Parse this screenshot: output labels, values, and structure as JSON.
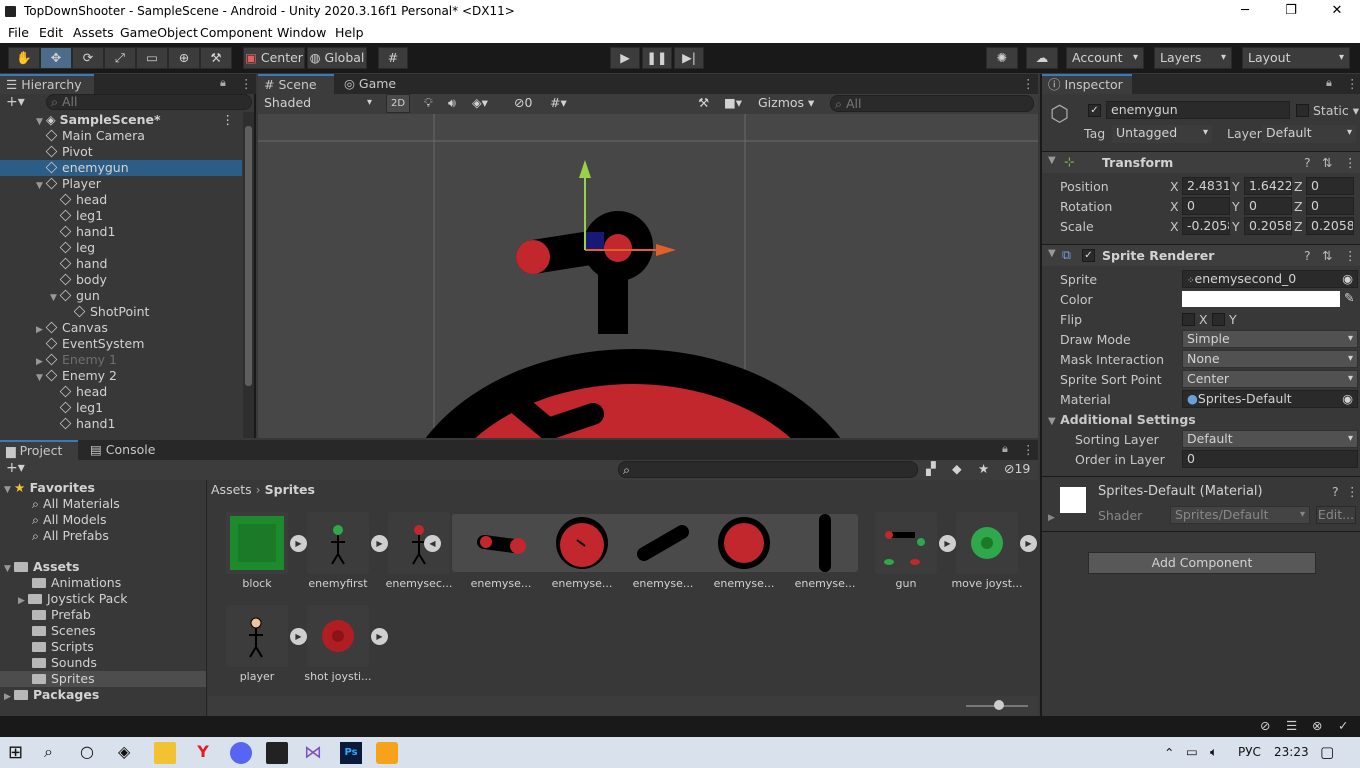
{
  "window": {
    "title": "TopDownShooter - SampleScene - Android - Unity 2020.3.16f1 Personal* <DX11>",
    "minimize": "─",
    "maximize": "❐",
    "close": "✕"
  },
  "menu": [
    "File",
    "Edit",
    "Assets",
    "GameObject",
    "Component",
    "Window",
    "Help"
  ],
  "toolbar": {
    "center": "Center",
    "global": "Global",
    "account": "Account",
    "layers": "Layers",
    "layout": "Layout"
  },
  "hierarchy": {
    "tab": "Hierarchy",
    "search_placeholder": "All",
    "items": [
      {
        "label": "SampleScene*",
        "indent": 0,
        "arrow": "▼",
        "bold": true,
        "scene": true
      },
      {
        "label": "Main Camera",
        "indent": 1,
        "arrow": ""
      },
      {
        "label": "Pivot",
        "indent": 1,
        "arrow": ""
      },
      {
        "label": "enemygun",
        "indent": 1,
        "arrow": "",
        "selected": true
      },
      {
        "label": "Player",
        "indent": 1,
        "arrow": "▼"
      },
      {
        "label": "head",
        "indent": 2,
        "arrow": ""
      },
      {
        "label": "leg1",
        "indent": 2,
        "arrow": ""
      },
      {
        "label": "hand1",
        "indent": 2,
        "arrow": ""
      },
      {
        "label": "leg",
        "indent": 2,
        "arrow": ""
      },
      {
        "label": "hand",
        "indent": 2,
        "arrow": ""
      },
      {
        "label": "body",
        "indent": 2,
        "arrow": ""
      },
      {
        "label": "gun",
        "indent": 2,
        "arrow": "▼"
      },
      {
        "label": "ShotPoint",
        "indent": 3,
        "arrow": ""
      },
      {
        "label": "Canvas",
        "indent": 1,
        "arrow": "▶"
      },
      {
        "label": "EventSystem",
        "indent": 1,
        "arrow": ""
      },
      {
        "label": "Enemy 1",
        "indent": 1,
        "arrow": "▶",
        "dim": true
      },
      {
        "label": "Enemy 2",
        "indent": 1,
        "arrow": "▼"
      },
      {
        "label": "head",
        "indent": 2,
        "arrow": ""
      },
      {
        "label": "leg1",
        "indent": 2,
        "arrow": ""
      },
      {
        "label": "hand1",
        "indent": 2,
        "arrow": ""
      }
    ]
  },
  "scene": {
    "tab_scene": "Scene",
    "tab_game": "Game",
    "shading": "Shaded",
    "mode_2d": "2D",
    "gizmos": "Gizmos",
    "search_placeholder": "All",
    "hidden_count": "0"
  },
  "inspector": {
    "tab": "Inspector",
    "object_name": "enemygun",
    "static": "Static",
    "tag_label": "Tag",
    "tag": "Untagged",
    "layer_label": "Layer",
    "layer": "Default",
    "transform": {
      "title": "Transform",
      "position_label": "Position",
      "rotation_label": "Rotation",
      "scale_label": "Scale",
      "position": [
        "2.48315",
        "1.6422",
        "0"
      ],
      "rotation": [
        "0",
        "0",
        "0"
      ],
      "scale": [
        "-0.2058",
        "0.20586",
        "0.20586"
      ]
    },
    "sprite_renderer": {
      "title": "Sprite Renderer",
      "sprite_label": "Sprite",
      "sprite": "enemysecond_0",
      "color_label": "Color",
      "color": "#ffffff",
      "flip_label": "Flip",
      "flip_x": "X",
      "flip_y": "Y",
      "draw_mode_label": "Draw Mode",
      "draw_mode": "Simple",
      "mask_label": "Mask Interaction",
      "mask": "None",
      "sort_point_label": "Sprite Sort Point",
      "sort_point": "Center",
      "material_label": "Material",
      "material": "Sprites-Default",
      "additional": "Additional Settings",
      "sorting_layer_label": "Sorting Layer",
      "sorting_layer": "Default",
      "order_label": "Order in Layer",
      "order": "0"
    },
    "material": {
      "title": "Sprites-Default (Material)",
      "shader_label": "Shader",
      "shader": "Sprites/Default",
      "edit": "Edit..."
    },
    "add_component": "Add Component"
  },
  "project": {
    "tab_project": "Project",
    "tab_console": "Console",
    "hidden_count": "19",
    "favorites": {
      "title": "Favorites",
      "items": [
        "All Materials",
        "All Models",
        "All Prefabs"
      ]
    },
    "assets": {
      "title": "Assets",
      "items": [
        "Animations",
        "Joystick Pack",
        "Prefab",
        "Scenes",
        "Scripts",
        "Sounds",
        "Sprites"
      ]
    },
    "packages": "Packages",
    "breadcrumb": [
      "Assets",
      "Sprites"
    ],
    "grid_row1": [
      "block",
      "enemyfirst",
      "enemysec...",
      "enemyse...",
      "enemyse...",
      "enemyse...",
      "enemyse...",
      "enemyse...",
      "gun",
      "move joyst..."
    ],
    "grid_row2": [
      "player",
      "shot joysti..."
    ]
  },
  "taskbar": {
    "lang": "РУС",
    "time": "23:23"
  },
  "colors": {
    "selection": "#2c5d87",
    "accent": "#3a79bb",
    "enemy_red": "#c1272d"
  }
}
